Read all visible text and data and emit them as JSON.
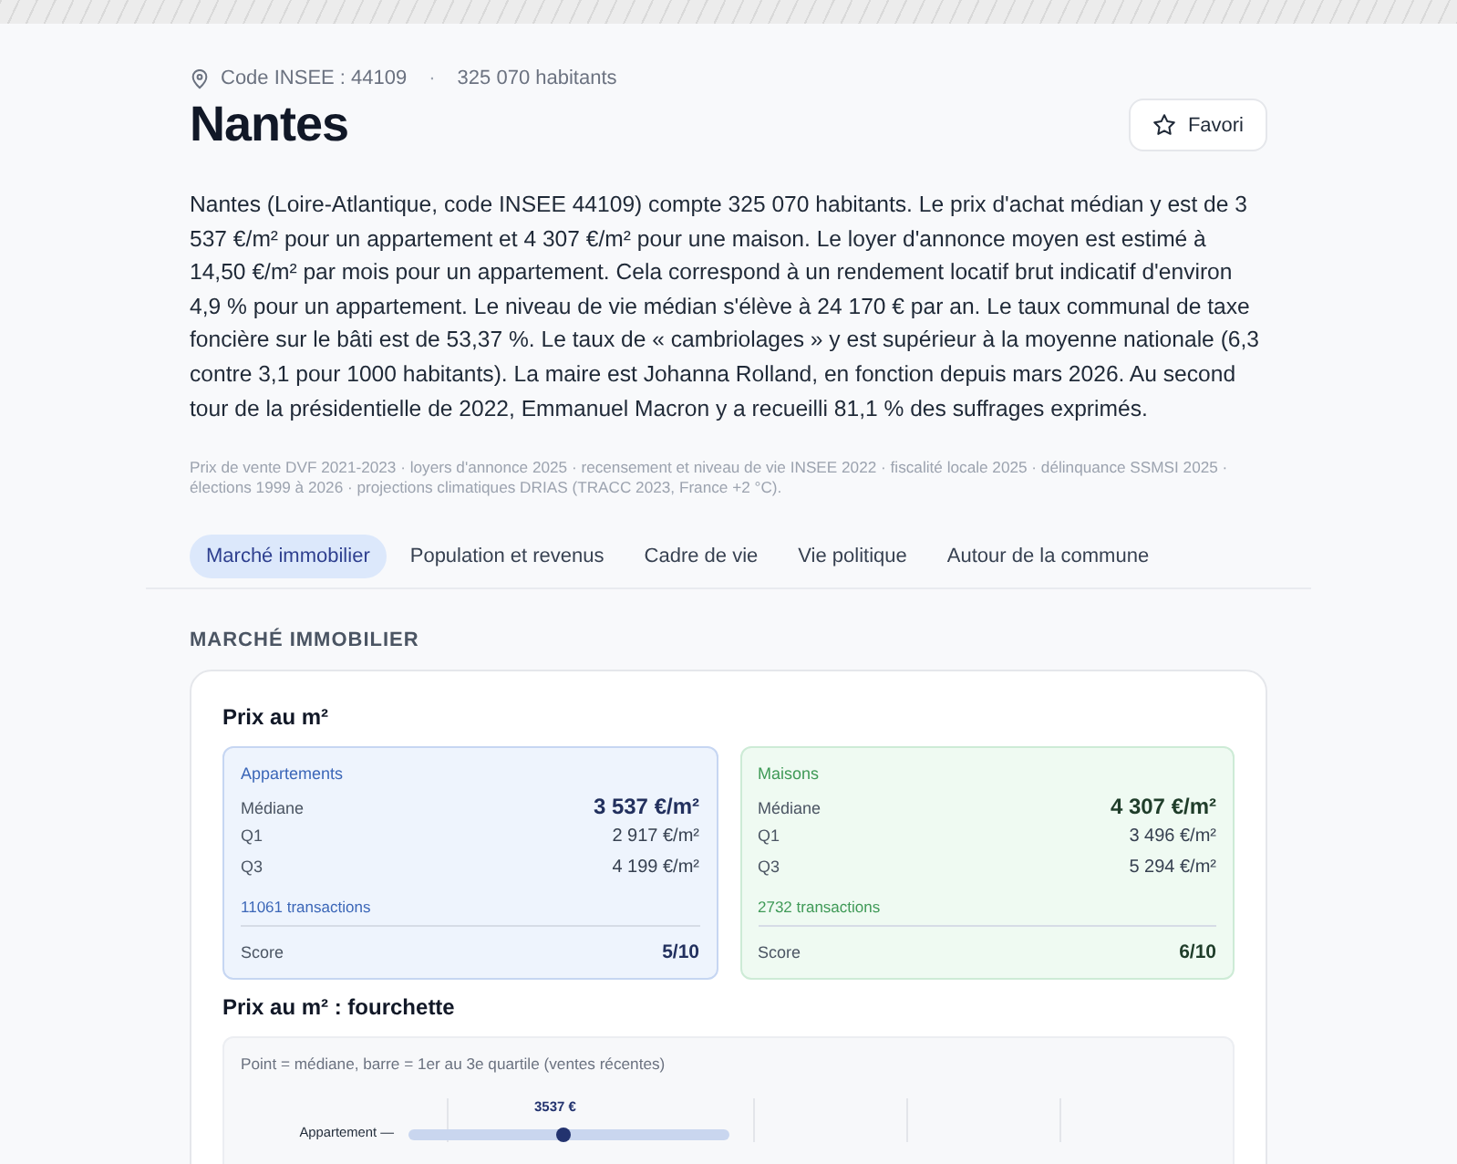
{
  "header": {
    "insee_code": "Code INSEE : 44109",
    "separator": "·",
    "population": "325 070 habitants",
    "title": "Nantes",
    "favorite_button": {
      "label": "Favori",
      "selected": false
    }
  },
  "summary": "Nantes (Loire-Atlantique, code INSEE 44109) compte 325 070 habitants. Le prix d'achat médian y est de 3 537 €/m² pour un appartement et 4 307 €/m² pour une maison. Le loyer d'annonce moyen est estimé à 14,50 €/m² par mois pour un appartement. Cela correspond à un rendement locatif brut indicatif d'environ 4,9 % pour un appartement. Le niveau de vie médian s'élève à 24 170 € par an. Le taux communal de taxe foncière sur le bâti est de 53,37 %. Le taux de « cambriolages » y est supérieur à la moyenne nationale (6,3 contre 3,1 pour 1000 habitants). La maire est Johanna Rolland, en fonction depuis mars 2026. Au second tour de la présidentielle de 2022, Emmanuel Macron y a recueilli 81,1 % des suffrages exprimés.",
  "sources": "Prix de vente DVF 2021-2023 · loyers d'annonce 2025 · recensement et niveau de vie INSEE 2022 · fiscalité locale 2025 · délinquance SSMSI 2025 · élections 1999 à 2026 · projections climatiques DRIAS (TRACC 2023, France +2 °C).",
  "tabs": [
    {
      "label": "Marché immobilier",
      "selected": true
    },
    {
      "label": "Population et revenus",
      "selected": false
    },
    {
      "label": "Cadre de vie",
      "selected": false
    },
    {
      "label": "Vie politique",
      "selected": false
    },
    {
      "label": "Autour de la commune",
      "selected": false
    }
  ],
  "section": {
    "title": "MARCHÉ IMMOBILIER",
    "card": {
      "title": "Prix au m²",
      "segments": [
        {
          "kind": "appartement",
          "title": "Appartements",
          "rows": [
            {
              "label": "Médiane",
              "value": "3 537 €/m²",
              "kind": "main"
            },
            {
              "label": "Q1",
              "value": "2 917 €/m²",
              "kind": "plain"
            },
            {
              "label": "Q3",
              "value": "4 199 €/m²",
              "kind": "plain"
            }
          ],
          "transactions": "11061 transactions",
          "score_label": "Score",
          "score": "5/10"
        },
        {
          "kind": "maison",
          "title": "Maisons",
          "rows": [
            {
              "label": "Médiane",
              "value": "4 307 €/m²",
              "kind": "main"
            },
            {
              "label": "Q1",
              "value": "3 496 €/m²",
              "kind": "plain"
            },
            {
              "label": "Q3",
              "value": "5 294 €/m²",
              "kind": "plain"
            }
          ],
          "transactions": "2732 transactions",
          "score_label": "Score",
          "score": "6/10"
        }
      ],
      "range_title": "Prix au m² : fourchette",
      "range_chart": {
        "caption": "Point = médiane, barre = 1er au 3e quartile (ventes récentes)",
        "rows": [
          {
            "label": "Appartement —",
            "value_label": "3537 €"
          }
        ]
      }
    }
  }
}
